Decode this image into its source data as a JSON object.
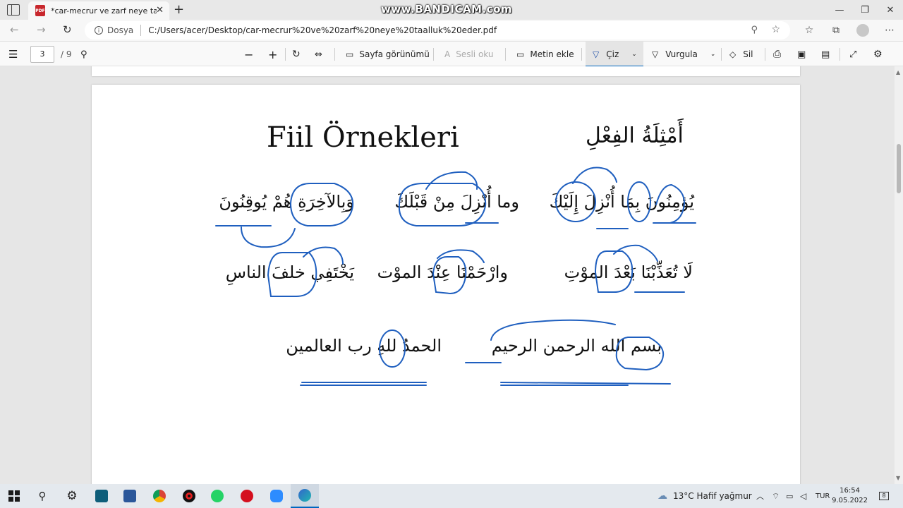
{
  "browser": {
    "tab_title": "*car-mecrur ve zarf neye taalluk",
    "pdf_badge": "PDF",
    "watermark": "www.BANDICAM.com",
    "site_label": "Dosya",
    "url": "C:/Users/acer/Desktop/car-mecrur%20ve%20zarf%20neye%20taalluk%20eder.pdf"
  },
  "pdf_toolbar": {
    "page_current": "3",
    "page_total": "/ 9",
    "page_view": "Sayfa görünümü",
    "read_aloud": "Sesli oku",
    "add_text": "Metin ekle",
    "draw": "Çiz",
    "highlight": "Vurgula",
    "erase": "Sil"
  },
  "document": {
    "title_latin": "Fiil Örnekleri",
    "title_arabic": "أَمْثِلَةُ الفِعْلِ",
    "row1": {
      "right": "يُؤمِنُونَ بِمَا أُنْزِلَ إِلَيْكَ",
      "middle": "وما أُنْزِلَ مِنْ قَبْلَكَ",
      "left": "وَبِالآخِرَةِ هُمْ يُوقِنُونَ"
    },
    "row2": {
      "right": "لَا تُعَذِّبْنَا بَعْدَ الموْتِ",
      "middle": "وارْحَمْنَا عِنْدَ الموْت",
      "left": "يَخْتَفِي خلفَ الناسِ"
    },
    "row3": {
      "right": "بسم الله الرحمن الرحيم",
      "left": "الحمدُ للهِ رب العالمين"
    },
    "ink_color": "#1f5fbf"
  },
  "taskbar": {
    "weather": "13°C  Hafif yağmur",
    "language": "TUR",
    "time": "16:54",
    "date": "9.05.2022",
    "notifications": "8"
  }
}
